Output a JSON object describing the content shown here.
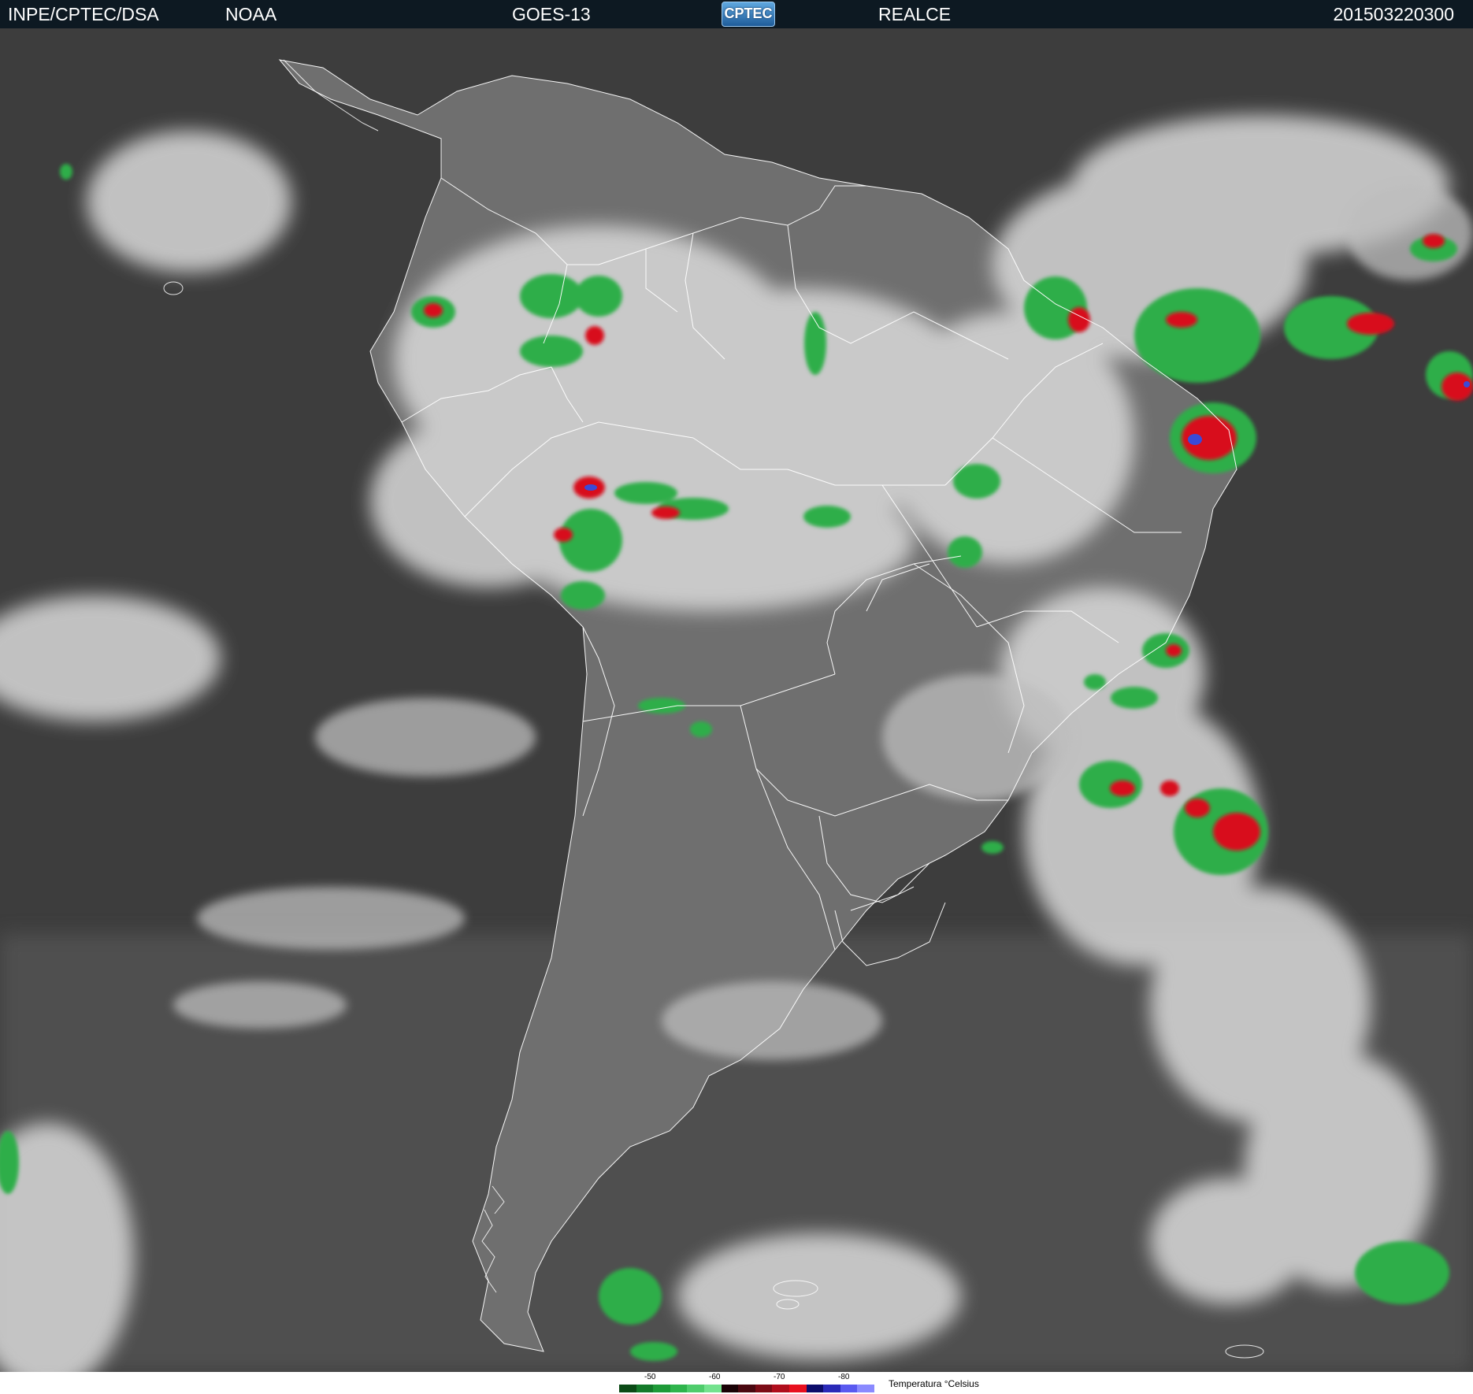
{
  "header": {
    "institution": "INPE/CPTEC/DSA",
    "agency": "NOAA",
    "satellite": "GOES-13",
    "logo_text": "CPTEC",
    "product": "REALCE",
    "timestamp": "201503220300"
  },
  "scale": {
    "ticks": [
      "-50",
      "-60",
      "-70",
      "-80"
    ],
    "label": "Temperatura °Celsius",
    "colors": [
      "#0b4a16",
      "#147a2a",
      "#1e9a38",
      "#2fb44c",
      "#4fcc6c",
      "#74e28e",
      "#1a0206",
      "#4a0810",
      "#7c0c16",
      "#b00e1c",
      "#e8101e",
      "#0c0c6a",
      "#2a2ab8",
      "#5a5af0",
      "#8a8aff"
    ]
  },
  "colors": {
    "cold_cloud_green": "#3cb04c",
    "very_cold_red": "#d8101e",
    "coldest_blue": "#3a4ad8",
    "ocean_dark": "#3c3c3c",
    "land_gray": "#6e6e6e"
  }
}
